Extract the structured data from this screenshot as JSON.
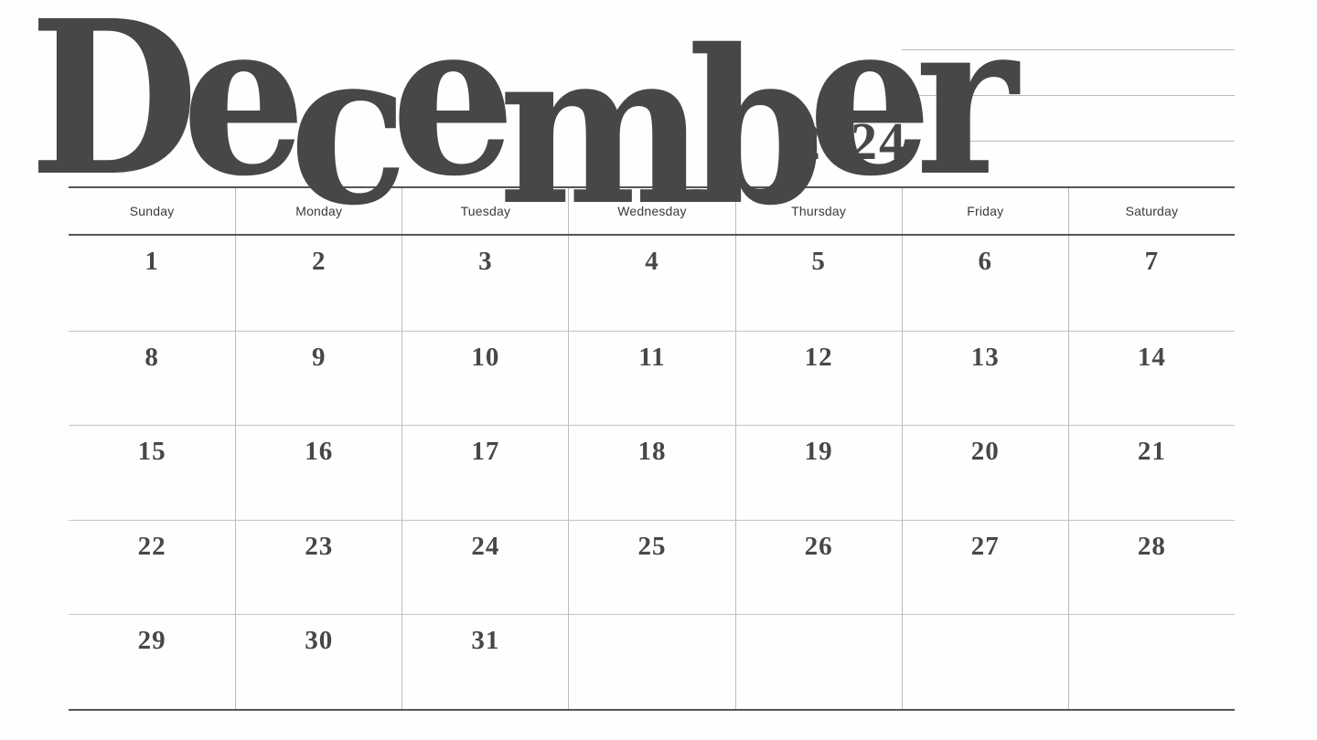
{
  "title": {
    "month": "December",
    "year": "2024"
  },
  "notes": {
    "line_count": 3
  },
  "calendar": {
    "weekdays": [
      "Sunday",
      "Monday",
      "Tuesday",
      "Wednesday",
      "Thursday",
      "Friday",
      "Saturday"
    ],
    "weeks": [
      [
        "1",
        "2",
        "3",
        "4",
        "5",
        "6",
        "7"
      ],
      [
        "8",
        "9",
        "10",
        "11",
        "12",
        "13",
        "14"
      ],
      [
        "15",
        "16",
        "17",
        "18",
        "19",
        "20",
        "21"
      ],
      [
        "22",
        "23",
        "24",
        "25",
        "26",
        "27",
        "28"
      ],
      [
        "29",
        "30",
        "31",
        "",
        "",
        "",
        ""
      ]
    ]
  },
  "colors": {
    "ink": "#474747",
    "grid_major": "#555555",
    "grid_minor": "#bdbdbd",
    "background": "#fefefe"
  }
}
